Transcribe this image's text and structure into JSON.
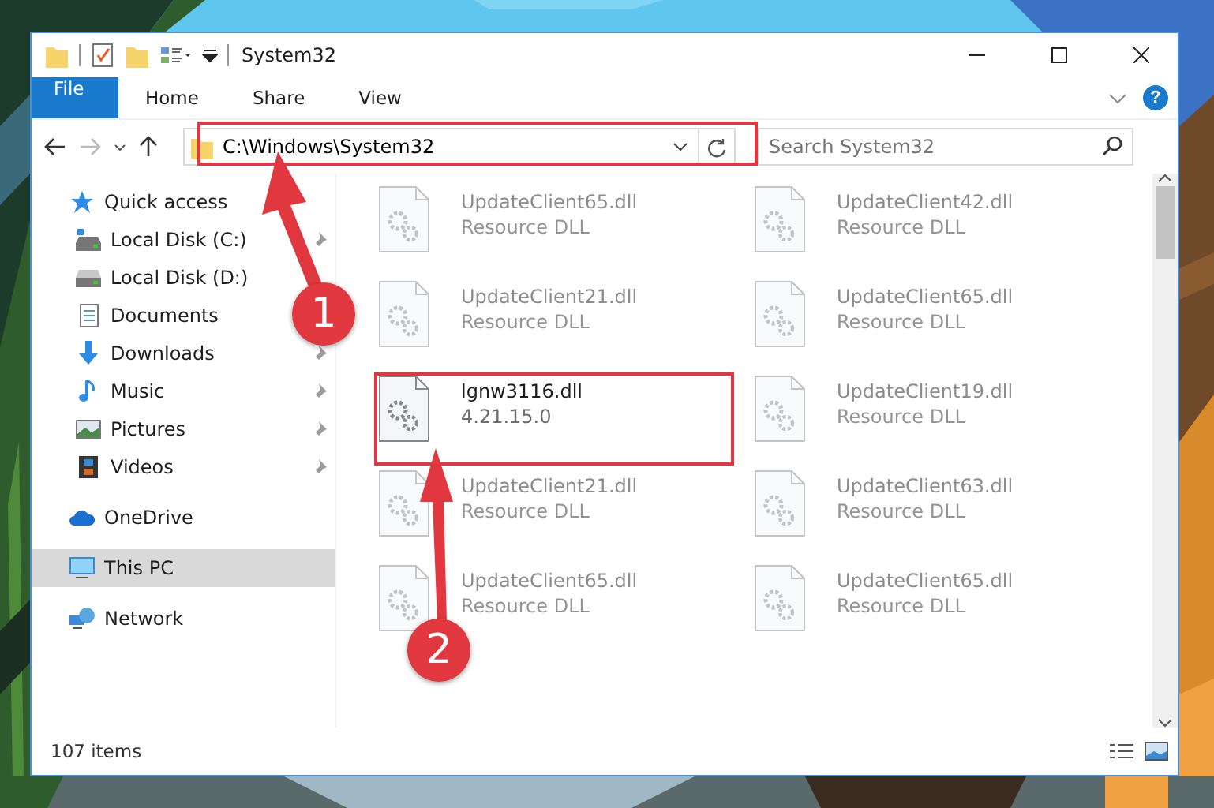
{
  "window": {
    "title": "System32"
  },
  "ribbon_tabs": [
    {
      "label": "File",
      "kind": "file"
    },
    {
      "label": "Home",
      "kind": "plain"
    },
    {
      "label": "Share",
      "kind": "plain"
    },
    {
      "label": "View",
      "kind": "plain"
    }
  ],
  "help": {
    "label": "?"
  },
  "address": {
    "value": "C:\\Windows\\System32"
  },
  "search": {
    "placeholder": "Search System32"
  },
  "sidebar": {
    "items": [
      {
        "label": "Quick access",
        "kind": "star",
        "selected": false,
        "children": [
          {
            "label": "Local Disk (C:)",
            "kind": "drive-c",
            "pinned": true,
            "selected": false
          },
          {
            "label": "Local Disk (D:)",
            "kind": "drive",
            "pinned": false,
            "selected": false
          },
          {
            "label": "Documents",
            "kind": "documents",
            "pinned": false,
            "selected": false
          },
          {
            "label": "Downloads",
            "kind": "downloads",
            "pinned": true,
            "selected": false
          },
          {
            "label": "Music",
            "kind": "music",
            "pinned": true,
            "selected": false
          },
          {
            "label": "Pictures",
            "kind": "pictures",
            "pinned": true,
            "selected": false
          },
          {
            "label": "Videos",
            "kind": "videos",
            "pinned": true,
            "selected": false
          }
        ]
      },
      {
        "label": "OneDrive",
        "kind": "cloud",
        "selected": false
      },
      {
        "label": "This PC",
        "kind": "pc",
        "selected": true
      },
      {
        "label": "Network",
        "kind": "network",
        "selected": false
      }
    ]
  },
  "files": [
    {
      "name": "UpdateClient65.dll",
      "detail": "Resource DLL",
      "blurred": true
    },
    {
      "name": "UpdateClient42.dll",
      "detail": "Resource DLL",
      "blurred": true
    },
    {
      "name": "UpdateClient21.dll",
      "detail": "Resource DLL",
      "blurred": true
    },
    {
      "name": "UpdateClient65.dll",
      "detail": "Resource DLL",
      "blurred": true
    },
    {
      "name": "lgnw3116.dll",
      "detail": "4.21.15.0",
      "blurred": false
    },
    {
      "name": "UpdateClient19.dll",
      "detail": "Resource DLL",
      "blurred": true
    },
    {
      "name": "UpdateClient21.dll",
      "detail": "Resource DLL",
      "blurred": true
    },
    {
      "name": "UpdateClient63.dll",
      "detail": "Resource DLL",
      "blurred": true
    },
    {
      "name": "UpdateClient65.dll",
      "detail": "Resource DLL",
      "blurred": true
    },
    {
      "name": "UpdateClient65.dll",
      "detail": "Resource DLL",
      "blurred": true
    }
  ],
  "status_bar": {
    "item_count": "107 items"
  },
  "annotations": [
    {
      "number": "1"
    },
    {
      "number": "2"
    }
  ]
}
